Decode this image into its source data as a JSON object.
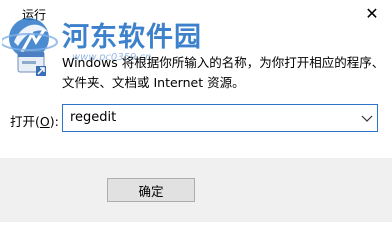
{
  "window": {
    "title": "运行",
    "close_symbol": "✕"
  },
  "watermark": {
    "brand": "河东软件园",
    "url": "www.pc0359.cn"
  },
  "dialog": {
    "description_line1": "Windows 将根据你所输入的名称，为你打开相应的程序、",
    "description_line2": "文件夹、文档或 Internet 资源。",
    "open_label_prefix": "打开(",
    "open_label_key": "O",
    "open_label_suffix": "):",
    "open_value": "regedit"
  },
  "buttons": {
    "ok_label": "确定"
  },
  "colors": {
    "accent": "#2e74c9",
    "footer": "#f0f0f0",
    "watermark": "#2d77c8"
  }
}
